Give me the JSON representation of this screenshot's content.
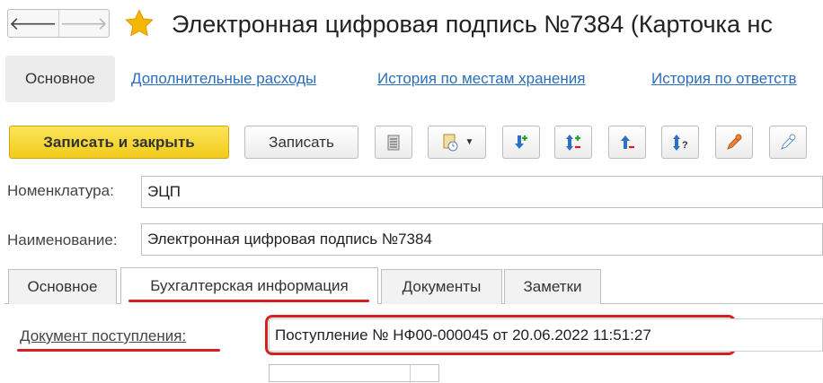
{
  "window": {
    "title": "Электронная цифровая подпись №7384 (Карточка нс",
    "back_glyph": "🡐",
    "forward_glyph": "🡒"
  },
  "sections": {
    "active": "Основное",
    "links": [
      "Дополнительные расходы",
      "История по местам хранения",
      "История по ответств"
    ]
  },
  "toolbar": {
    "save_close_label": "Записать и закрыть",
    "save_label": "Записать",
    "icons": [
      "list-icon",
      "report-dropdown-icon",
      "move-down-add-icon",
      "sort-add-remove-icon",
      "move-up-remove-icon",
      "sort-help-icon",
      "edit-pencil-icon",
      "edit-pencil-light-icon"
    ]
  },
  "form": {
    "nomenclature_label": "Номенклатура:",
    "nomenclature_value": "ЭЦП",
    "name_label": "Наименование:",
    "name_value": "Электронная цифровая подпись №7384"
  },
  "tabs": [
    "Основное",
    "Бухгалтерская информация",
    "Документы",
    "Заметки"
  ],
  "active_tab": "Бухгалтерская информация",
  "accounting": {
    "receipt_doc_label": "Документ поступления:",
    "receipt_doc_value": "Поступление № НФ00-000045 от 20.06.2022 11:51:27"
  },
  "colors": {
    "primary_button": "#f2cb1b",
    "link": "#2a6ebb",
    "highlight": "#d42020",
    "star": "#f5b800"
  }
}
